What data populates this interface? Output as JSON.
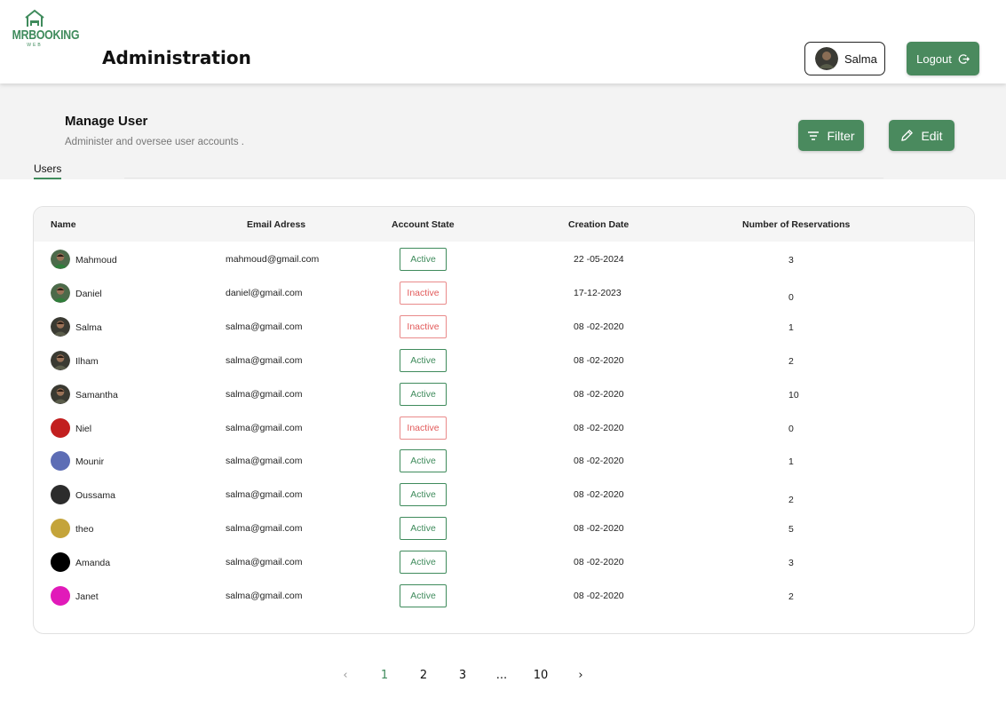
{
  "logo": {
    "text": "MRBOOKING",
    "sub": "WEB"
  },
  "header": {
    "title": "Administration",
    "user_name": "Salma",
    "logout_label": "Logout"
  },
  "section": {
    "title": "Manage User",
    "subtitle": "Administer and oversee user accounts .",
    "filter_label": "Filter",
    "edit_label": "Edit",
    "tab_label": "Users"
  },
  "table": {
    "columns": [
      "Name",
      "Email Adress",
      "Account State",
      "Creation Date",
      "Number of Reservations"
    ],
    "rows": [
      {
        "name": "Mahmoud",
        "email": "mahmoud@gmail.com",
        "state": "Active",
        "date": "22 -05-2024",
        "reservations": "3",
        "avatar": "photo-green"
      },
      {
        "name": "Daniel",
        "email": "daniel@gmail.com",
        "state": "Inactive",
        "date": "17-12-2023",
        "reservations": "0",
        "avatar": "photo-green"
      },
      {
        "name": "Salma",
        "email": "salma@gmail.com",
        "state": "Inactive",
        "date": "08 -02-2020",
        "reservations": "1",
        "avatar": "photo-dark"
      },
      {
        "name": "Ilham",
        "email": "salma@gmail.com",
        "state": "Active",
        "date": "08 -02-2020",
        "reservations": "2",
        "avatar": "photo-dark"
      },
      {
        "name": "Samantha",
        "email": "salma@gmail.com",
        "state": "Active",
        "date": "08 -02-2020",
        "reservations": "10",
        "avatar": "photo-dark"
      },
      {
        "name": "Niel",
        "email": "salma@gmail.com",
        "state": "Inactive",
        "date": "08 -02-2020",
        "reservations": "0",
        "avatar": "#c21f1f"
      },
      {
        "name": "Mounir",
        "email": "salma@gmail.com",
        "state": "Active",
        "date": "08 -02-2020",
        "reservations": "1",
        "avatar": "#5d6db5"
      },
      {
        "name": "Oussama",
        "email": "salma@gmail.com",
        "state": "Active",
        "date": "08 -02-2020",
        "reservations": "2",
        "avatar": "#2c2c2c"
      },
      {
        "name": "theo",
        "email": "salma@gmail.com",
        "state": "Active",
        "date": "08 -02-2020",
        "reservations": "5",
        "avatar": "#c4a43a"
      },
      {
        "name": "Amanda",
        "email": "salma@gmail.com",
        "state": "Active",
        "date": "08 -02-2020",
        "reservations": "3",
        "avatar": "#000000"
      },
      {
        "name": "Janet",
        "email": "salma@gmail.com",
        "state": "Active",
        "date": "08 -02-2020",
        "reservations": "2",
        "avatar": "#e11ab9"
      }
    ]
  },
  "pagination": {
    "pages": [
      "1",
      "2",
      "3",
      "...",
      "10"
    ],
    "current": "1"
  },
  "colors": {
    "accent": "#4a8a5e",
    "active": "#3f8b5c",
    "inactive": "#e25a5a"
  }
}
